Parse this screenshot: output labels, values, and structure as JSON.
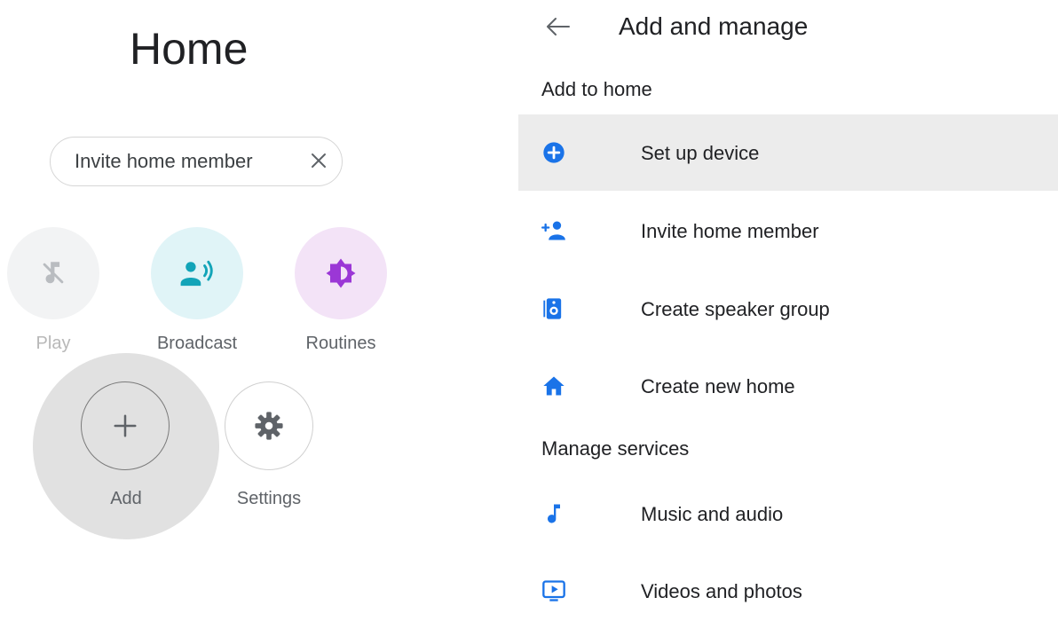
{
  "home": {
    "title": "Home",
    "chip": {
      "label": "Invite home member"
    },
    "actions": {
      "play": "Play",
      "broadcast": "Broadcast",
      "routines": "Routines",
      "add": "Add",
      "settings": "Settings"
    }
  },
  "panel": {
    "title": "Add and manage",
    "sections": [
      {
        "header": "Add to home",
        "items": [
          {
            "label": "Set up device",
            "icon": "add-circle-icon"
          },
          {
            "label": "Invite home member",
            "icon": "person-add-icon"
          },
          {
            "label": "Create speaker group",
            "icon": "speaker-icon"
          },
          {
            "label": "Create new home",
            "icon": "home-icon"
          }
        ]
      },
      {
        "header": "Manage services",
        "items": [
          {
            "label": "Music and audio",
            "icon": "music-note-icon"
          },
          {
            "label": "Videos and photos",
            "icon": "tv-play-icon"
          }
        ]
      }
    ]
  },
  "colors": {
    "accent_blue": "#1a73e8",
    "broadcast_teal": "#12b5cb",
    "routines_purple": "#a142f4",
    "highlight_row": "#ececec",
    "add_halo": "#e1e1e1"
  }
}
